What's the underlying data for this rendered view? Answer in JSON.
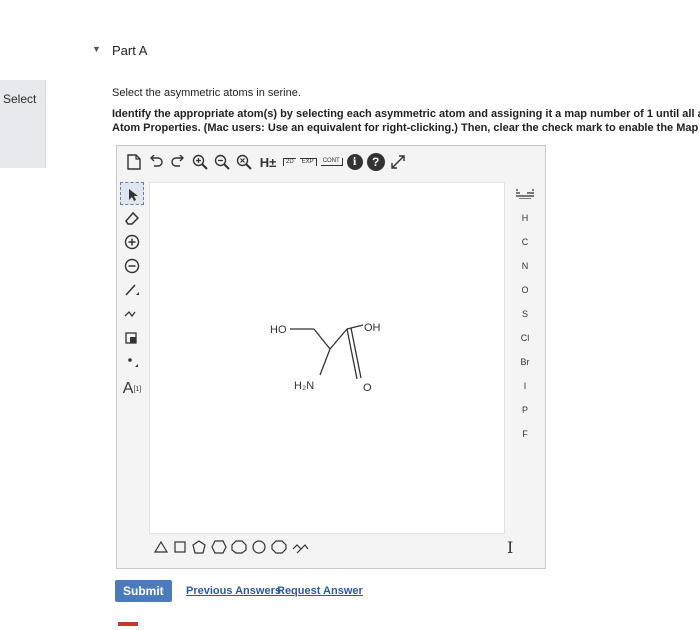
{
  "sidebar": {
    "tab_label": "Select"
  },
  "part": {
    "title": "Part A"
  },
  "question": {
    "prompt": "Select the asymmetric atoms in serine.",
    "instruction_line1": "Identify the appropriate atom(s) by selecting each asymmetric atom and assigning it a map number of 1 until all asymmetric",
    "instruction_line2": "Atom Properties. (Mac users: Use an equivalent for right-clicking.) Then, clear the check mark to enable the Map field"
  },
  "toolbar": {
    "h_label": "H±",
    "twod_label": "2D",
    "exp_label": "EXP",
    "cont_label": "CONT",
    "info_label": "i",
    "help_label": "?"
  },
  "left_tools": {
    "atom_label": "A",
    "atom_superscript": "[1]"
  },
  "molecule": {
    "ho": "HO",
    "oh": "OH",
    "h2n": "H₂N",
    "o": "O"
  },
  "elements": [
    "H",
    "C",
    "N",
    "O",
    "S",
    "Cl",
    "Br",
    "I",
    "P",
    "F"
  ],
  "footer": {
    "submit_label": "Submit",
    "previous_label": "Previous Answers",
    "request_label": "Request Answer"
  }
}
